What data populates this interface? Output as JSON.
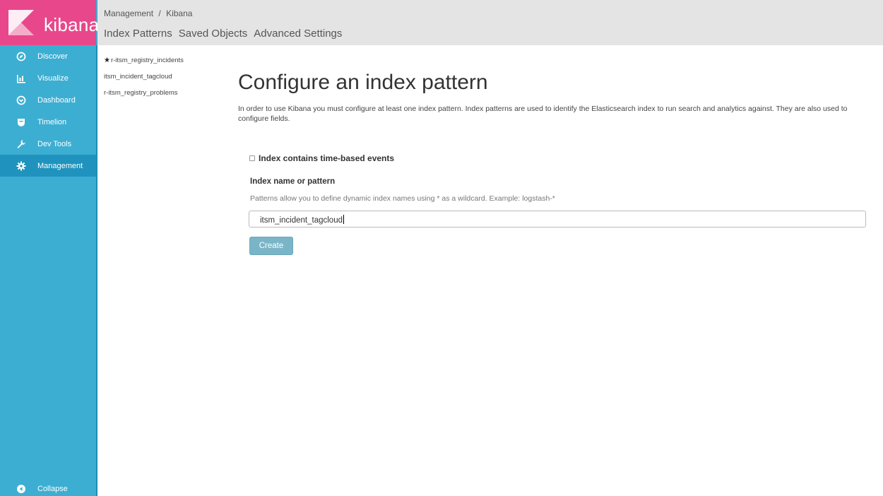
{
  "app": {
    "logo_text": "kibana"
  },
  "sidebar": {
    "items": [
      {
        "label": "Discover",
        "icon": "compass-icon"
      },
      {
        "label": "Visualize",
        "icon": "bar-chart-icon"
      },
      {
        "label": "Dashboard",
        "icon": "dashboard-icon"
      },
      {
        "label": "Timelion",
        "icon": "shield-icon"
      },
      {
        "label": "Dev Tools",
        "icon": "wrench-icon"
      },
      {
        "label": "Management",
        "icon": "gear-icon",
        "active": true
      }
    ],
    "collapse_label": "Collapse"
  },
  "header": {
    "breadcrumb": [
      "Management",
      "/",
      "Kibana"
    ],
    "tabs": [
      "Index Patterns",
      "Saved Objects",
      "Advanced Settings"
    ]
  },
  "index_patterns": {
    "items": [
      {
        "label": "r-itsm_registry_incidents",
        "default": true
      },
      {
        "label": "itsm_incident_tagcloud",
        "default": false
      },
      {
        "label": "r-itsm_registry_problems",
        "default": false
      }
    ]
  },
  "main": {
    "title": "Configure an index pattern",
    "description": "In order to use Kibana you must configure at least one index pattern. Index patterns are used to identify the Elasticsearch index to run search and analytics against. They are also used to configure fields.",
    "time_based_checkbox": {
      "label": "Index contains time-based events",
      "checked": false
    },
    "index_name_label": "Index name or pattern",
    "index_name_help": "Patterns allow you to define dynamic index names using * as a wildcard. Example: logstash-*",
    "index_name_value": "itsm_incident_tagcloud",
    "create_button": "Create"
  },
  "colors": {
    "sidebar": "#3caed2",
    "sidebar_active": "#1f93bd",
    "logo_bg": "#e8488b",
    "topbar": "#e4e4e4",
    "button": "#7ab5c7"
  }
}
